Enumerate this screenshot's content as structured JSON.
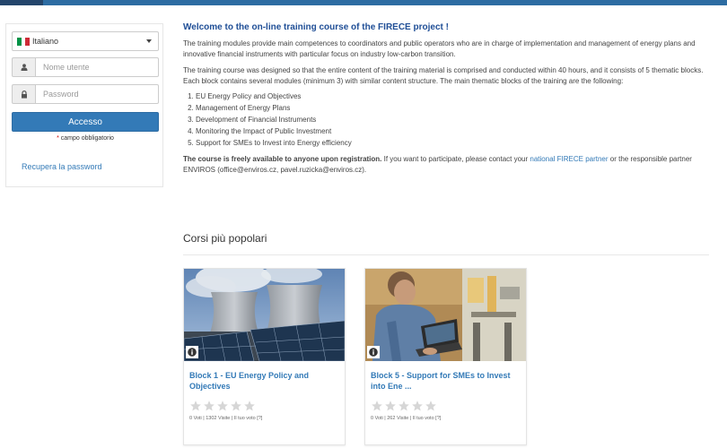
{
  "login": {
    "language": "Italiano",
    "username_placeholder": "Nome utente",
    "password_placeholder": "Password",
    "login_button": "Accesso",
    "required_marker": "*",
    "required_note": " campo obbligatorio",
    "forgot_password": "Recupera la password"
  },
  "main": {
    "welcome_title": "Welcome to the on-line training course of the FIRECE project !",
    "para1": "The training modules provide main competences to coordinators and public operators who are in charge of implementation and management of energy plans and innovative financial instruments with particular focus on industry low-carbon transition.",
    "para2": "The training course was designed so that the entire content of the training material is comprised and conducted within 40 hours, and it consists of 5 thematic blocks. Each block contains several modules (minimum 3) with similar content structure. The main thematic blocks of the training are the following:",
    "blocks": [
      "EU Energy Policy and Objectives",
      "Management of Energy Plans",
      "Development of Financial Instruments",
      "Monitoring the Impact of Public Investment",
      "Support for SMEs to Invest into Energy efficiency"
    ],
    "free_bold": "The course is freely available to anyone upon registration.",
    "free_text1": " If you want to participate, please contact your ",
    "partner_link": "national FIRECE partner",
    "free_text2": " or the responsible partner ENVIROS (office@enviros.cz, pavel.ruzicka@enviros.cz)."
  },
  "popular": {
    "title": "Corsi più popolari",
    "courses": [
      {
        "title": "Block 1 - EU Energy Policy and Objectives",
        "meta": "0 Voti | 1302 Visite | Il tuo voto [?]",
        "image": "power-plant-solar-panels"
      },
      {
        "title": "Block 5 - Support for SMEs to Invest into Ene ...",
        "meta": "0 Voti | 262 Visite | Il tuo voto [?]",
        "image": "worker-with-laptop"
      }
    ]
  },
  "colors": {
    "brand_blue": "#337ab7",
    "title_blue": "#1f4e96",
    "top_bar": "#2d6ca2"
  }
}
